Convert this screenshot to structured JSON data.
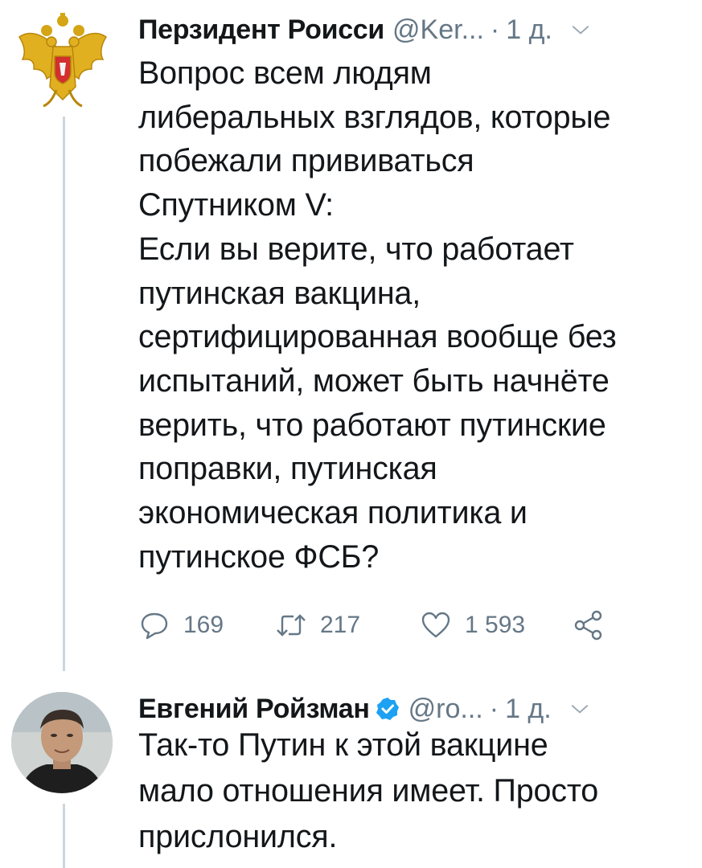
{
  "tweets": [
    {
      "author": {
        "name": "Перзидент Роисси",
        "handle": "@Ker...",
        "avatar_icon": "russian-coat-of-arms-icon",
        "verified": false
      },
      "separator": "·",
      "time": "1 д.",
      "text_lines": [
        "Вопрос всем людям",
        "либеральных взглядов, которые",
        "побежали прививаться",
        "Спутником V:",
        "Если вы верите, что работает",
        "путинская вакцина,",
        "сертифицированная вообще без",
        "испытаний, может быть начнёте",
        "верить, что работают путинские",
        "поправки, путинская",
        "экономическая политика и",
        "путинское ФСБ?"
      ],
      "actions": {
        "replies": "169",
        "retweets": "217",
        "likes": "1 593"
      }
    },
    {
      "author": {
        "name": "Евгений Ройзман",
        "handle": "@ro...",
        "avatar_icon": "user-photo-avatar",
        "verified": true
      },
      "separator": "·",
      "time": "1 д.",
      "text_lines": [
        "Так-то Путин к этой вакцине",
        "мало отношения имеет. Просто",
        "прислонился."
      ]
    }
  ],
  "colors": {
    "text": "#14171a",
    "muted": "#657786",
    "thread_line": "#ccd6dd",
    "verified": "#1da1f2"
  }
}
